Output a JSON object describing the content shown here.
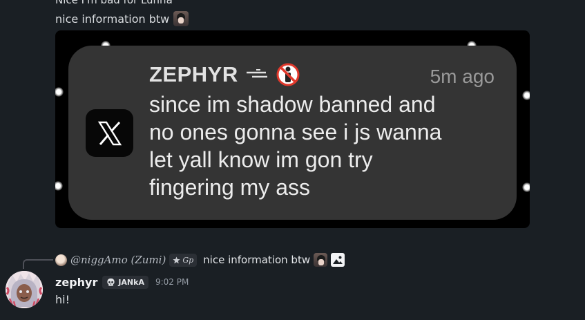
{
  "previous_messages": {
    "partial_text": "Nice I'm bad for Lunna",
    "message_text": "nice information btw"
  },
  "embedded_image": {
    "notification": {
      "app_icon": "x-logo-icon",
      "sender": "ZEPHYR",
      "sender_emojis": [
        "stacked-lines-icon",
        "no-entry-person-icon"
      ],
      "time": "5m ago",
      "body": "since im shadow banned and\nno ones gonna see i js wanna\nlet yall know im gon try\nfingering my ass"
    }
  },
  "reply": {
    "username": "@niggAmo (Zumi)",
    "tag": "Gp",
    "text": "nice information btw",
    "attachment_icon": "image-icon"
  },
  "message": {
    "username": "zephyr",
    "guild_tag": "JANkA",
    "timestamp": "9:02 PM",
    "text": "hi!"
  },
  "colors": {
    "background": "#1a1f24",
    "toast": "#343434",
    "muted": "#949ba4"
  }
}
